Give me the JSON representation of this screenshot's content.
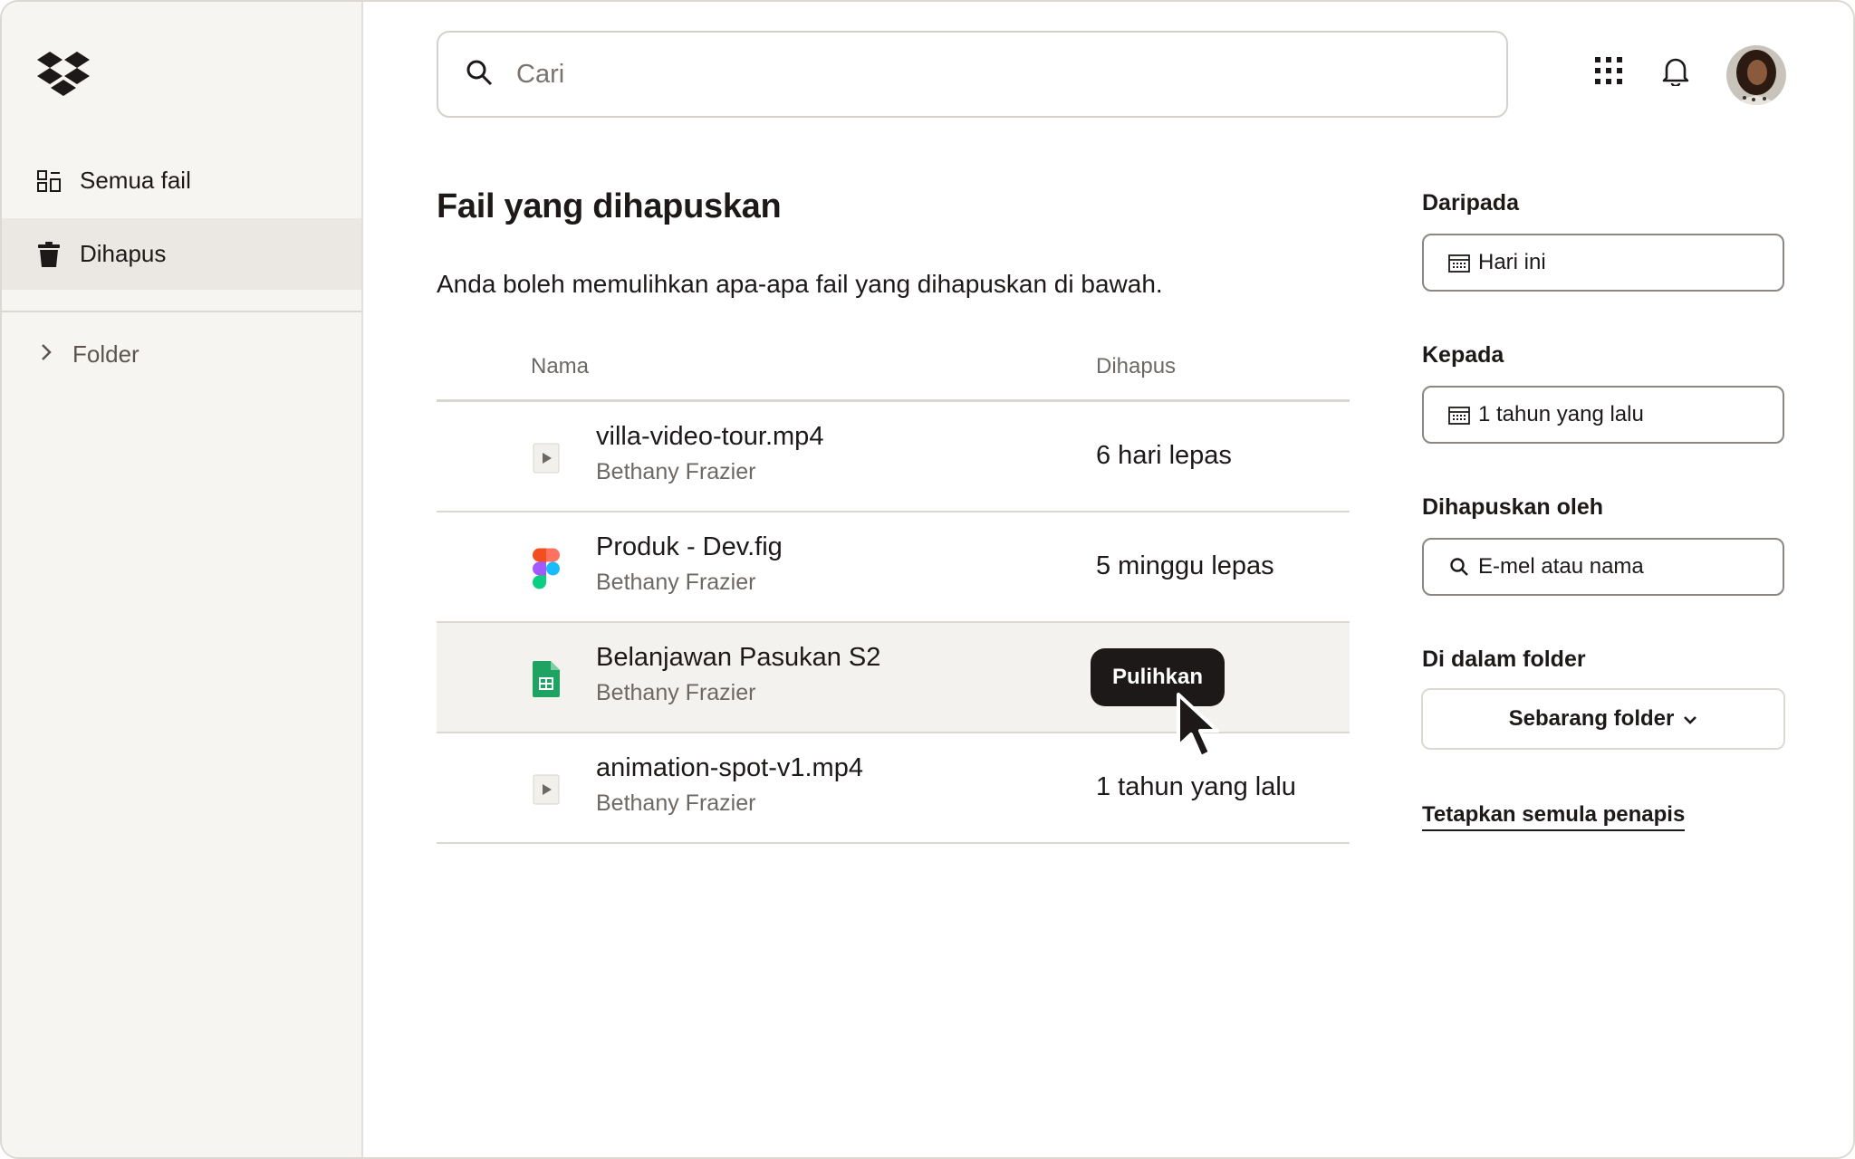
{
  "sidebar": {
    "items": [
      {
        "label": "Semua fail",
        "icon": "grid-layout-icon"
      },
      {
        "label": "Dihapus",
        "icon": "trash-icon"
      }
    ],
    "folder_label": "Folder"
  },
  "header": {
    "search_placeholder": "Cari"
  },
  "main": {
    "title": "Fail yang dihapuskan",
    "description": "Anda boleh memulihkan apa-apa fail yang dihapuskan di bawah.",
    "columns": {
      "name": "Nama",
      "deleted": "Dihapus"
    },
    "rows": [
      {
        "name": "villa-video-tour.mp4",
        "owner": "Bethany Frazier",
        "deleted": "6 hari lepas",
        "icon": "video-file-icon"
      },
      {
        "name": "Produk - Dev.fig",
        "owner": "Bethany Frazier",
        "deleted": "5 minggu lepas",
        "icon": "figma-file-icon"
      },
      {
        "name": "Belanjawan Pasukan S2",
        "owner": "Bethany Frazier",
        "deleted": "",
        "icon": "spreadsheet-file-icon",
        "action": "Pulihkan"
      },
      {
        "name": "animation-spot-v1.mp4",
        "owner": "Bethany Frazier",
        "deleted": "1 tahun yang lalu",
        "icon": "video-file-icon"
      }
    ]
  },
  "filters": {
    "from_label": "Daripada",
    "from_value": "Hari ini",
    "to_label": "Kepada",
    "to_value": "1 tahun yang lalu",
    "deleted_by_label": "Dihapuskan oleh",
    "deleted_by_placeholder": "E-mel atau nama",
    "folder_label": "Di dalam folder",
    "folder_value": "Sebarang folder",
    "reset_label": "Tetapkan semula penapis"
  },
  "colors": {
    "sidebar_bg": "#f7f5f2",
    "active_bg": "#ebe8e3",
    "text": "#1e1919",
    "muted": "#6d6864",
    "button_dark": "#1e1919",
    "sheets_green": "#1ea362"
  }
}
